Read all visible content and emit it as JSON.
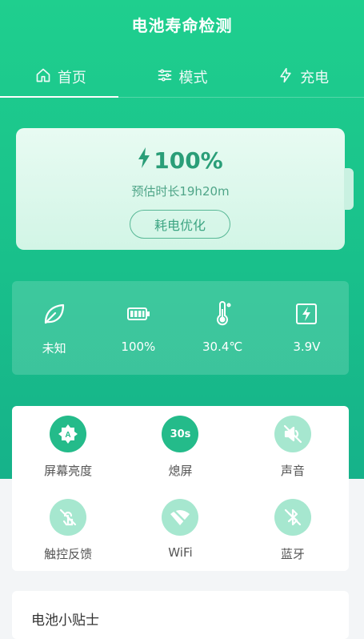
{
  "app": {
    "title": "电池寿命检测"
  },
  "tabs": [
    {
      "label": "首页",
      "icon": "home-icon",
      "active": true
    },
    {
      "label": "模式",
      "icon": "sliders-icon",
      "active": false
    },
    {
      "label": "充电",
      "icon": "bolt-icon",
      "active": false
    }
  ],
  "battery": {
    "level": "100%",
    "level_percent": 100,
    "estimate": "预估时长19h20m",
    "optimize_label": "耗电优化"
  },
  "stats": [
    {
      "icon": "leaf-icon",
      "value": "未知"
    },
    {
      "icon": "battery-icon",
      "value": "100%"
    },
    {
      "icon": "thermometer-icon",
      "value": "30.4℃"
    },
    {
      "icon": "voltage-icon",
      "value": "3.9V"
    }
  ],
  "quick_settings": [
    {
      "label": "屏幕亮度",
      "icon": "brightness-auto-icon",
      "state": "on"
    },
    {
      "label": "熄屏",
      "icon": "timer-icon",
      "badge": "30s",
      "state": "on"
    },
    {
      "label": "声音",
      "icon": "volume-off-icon",
      "state": "off"
    },
    {
      "label": "触控反馈",
      "icon": "touch-icon",
      "state": "off"
    },
    {
      "label": "WiFi",
      "icon": "wifi-off-icon",
      "state": "off"
    },
    {
      "label": "蓝牙",
      "icon": "bluetooth-off-icon",
      "state": "off"
    }
  ],
  "tips": {
    "title": "电池小贴士"
  },
  "colors": {
    "primary": "#1fcf8e",
    "accent": "#24bb8a",
    "muted": "#a6e7cf"
  }
}
